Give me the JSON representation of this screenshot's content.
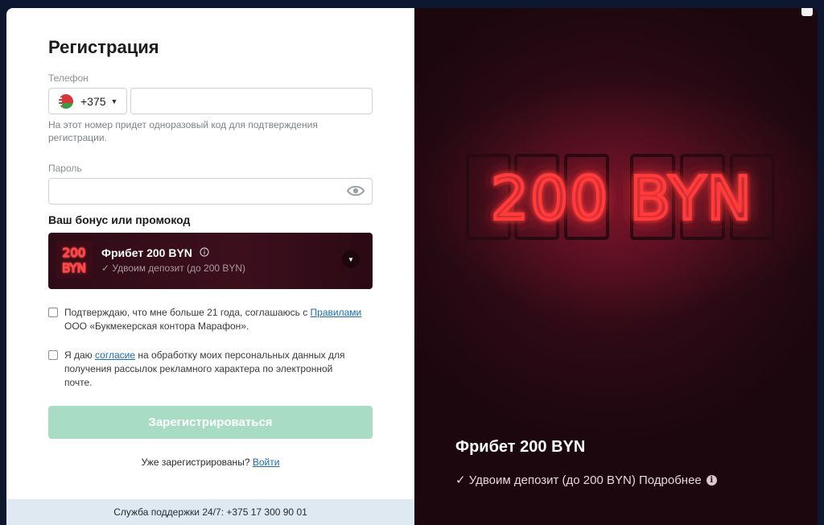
{
  "form": {
    "title": "Регистрация",
    "phone_label": "Телефон",
    "phone_code": "+375",
    "phone_value": "",
    "phone_hint": "На этот номер придет одноразовый код для подтверждения регистрации.",
    "password_label": "Пароль",
    "password_value": "",
    "bonus_title": "Ваш бонус или промокод",
    "bonus": {
      "name": "Фрибет 200 BYN",
      "sub": "✓ Удвоим депозит (до 200 BYN)",
      "thumb_text_1": "200",
      "thumb_text_2": "BYN"
    },
    "consent_1_pre": "Подтверждаю, что мне больше 21 года, соглашаюсь с ",
    "consent_1_link": "Правилами",
    "consent_1_post": " ООО «Букмекерская контора Марафон».",
    "consent_2_pre": "Я даю ",
    "consent_2_link": "согласие",
    "consent_2_post": " на обработку моих персональных данных для получения рассылок рекламного характера по электронной почте.",
    "register_label": "Зарегистрироваться",
    "already_text": "Уже зарегистрированы?",
    "login_label": "Войти",
    "support_text": "Служба поддержки 24/7: +375 17 300 90 01"
  },
  "promo": {
    "neon_text": "200 BYN",
    "title": "Фрибет 200 BYN",
    "subtitle": "✓ Удвоим депозит (до 200 BYN) Подробнее",
    "info_glyph": "i"
  },
  "colors": {
    "accent_green_disabled": "#a9dcc4",
    "link_blue": "#1a6bb5",
    "neon_red": "#ff3b3b",
    "promo_bg": "#2c0a15"
  },
  "icons": {
    "flag": "belarus-flag-icon",
    "eye": "eye-icon",
    "info": "info-icon",
    "arrow": "chevron-down-icon"
  }
}
